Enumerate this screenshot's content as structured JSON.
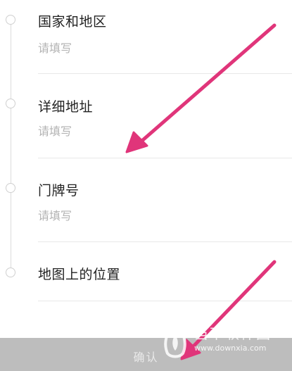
{
  "fields": [
    {
      "label": "国家和地区",
      "placeholder": "请填写"
    },
    {
      "label": "详细地址",
      "placeholder": "请填写"
    },
    {
      "label": "门牌号",
      "placeholder": "请填写"
    },
    {
      "label": "地图上的位置"
    }
  ],
  "confirm_label": "确认",
  "watermark": {
    "title": "当下软件园",
    "url": "www.downxia.com"
  },
  "colors": {
    "arrow": "#e0357a",
    "confirm_bg": "#bdbdbd",
    "placeholder": "#b3b3b3"
  }
}
